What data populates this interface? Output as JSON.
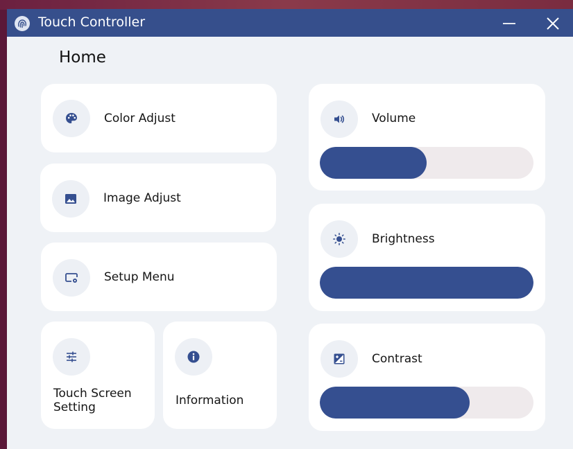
{
  "window": {
    "title": "Touch Controller",
    "icons": {
      "app": "fingerprint-icon",
      "minimize": "minimize-icon",
      "close": "close-icon"
    }
  },
  "page": {
    "title": "Home"
  },
  "menu": {
    "color_adjust": {
      "label": "Color Adjust",
      "icon": "palette-icon"
    },
    "image_adjust": {
      "label": "Image Adjust",
      "icon": "image-icon"
    },
    "setup_menu": {
      "label": "Setup Menu",
      "icon": "monitor-settings-icon"
    },
    "touch_screen_setting": {
      "label_line1": "Touch Screen",
      "label_line2": "Setting",
      "icon": "sliders-icon"
    },
    "information": {
      "label": "Information",
      "icon": "info-icon"
    }
  },
  "controls": {
    "volume": {
      "label": "Volume",
      "icon": "speaker-icon",
      "level": 0.5
    },
    "brightness": {
      "label": "Brightness",
      "icon": "sun-icon",
      "level": 1.0
    },
    "contrast": {
      "label": "Contrast",
      "icon": "contrast-icon",
      "level": 0.7
    }
  },
  "colors": {
    "accent": "#354f90",
    "titlebar": "#364f8c",
    "track": "#efeaec",
    "background": "#eff2f6",
    "card": "#ffffff"
  }
}
